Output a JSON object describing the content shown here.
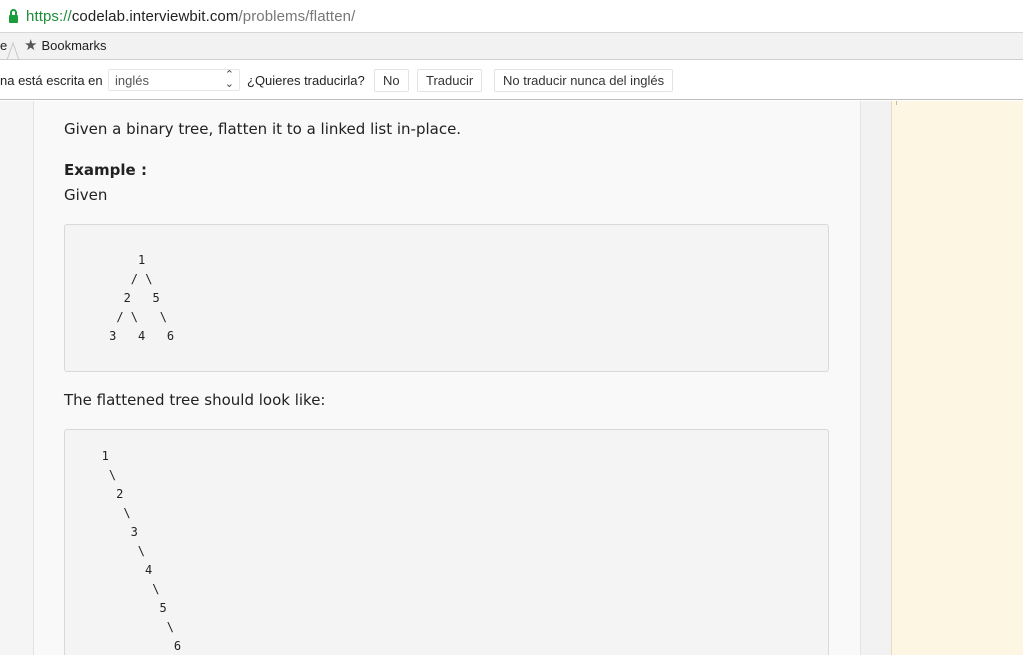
{
  "browser": {
    "url_scheme": "https://",
    "url_host": "codelab.interviewbit.com",
    "url_path": "/problems/flatten/"
  },
  "bookmarks": {
    "cut_label": "e",
    "label": "Bookmarks"
  },
  "translate": {
    "prefix": "na está escrita en",
    "language": "inglés",
    "question": "¿Quieres traducirla?",
    "no_label": "No",
    "translate_label": "Traducir",
    "never_label": "No traducir nunca del inglés"
  },
  "problem": {
    "intro": "Given a binary tree, flatten it to a linked list in-place.",
    "example_heading": "Example :",
    "given": "Given",
    "tree_lines": [
      "",
      "         1",
      "        / \\",
      "       2   5",
      "      / \\   \\",
      "     3   4   6",
      ""
    ],
    "flattened_text": "The flattened tree should look like:",
    "flat_lines": [
      "   1",
      "    \\",
      "     2",
      "      \\",
      "       3",
      "        \\",
      "         4",
      "          \\",
      "           5",
      "            \\",
      "             6"
    ]
  }
}
